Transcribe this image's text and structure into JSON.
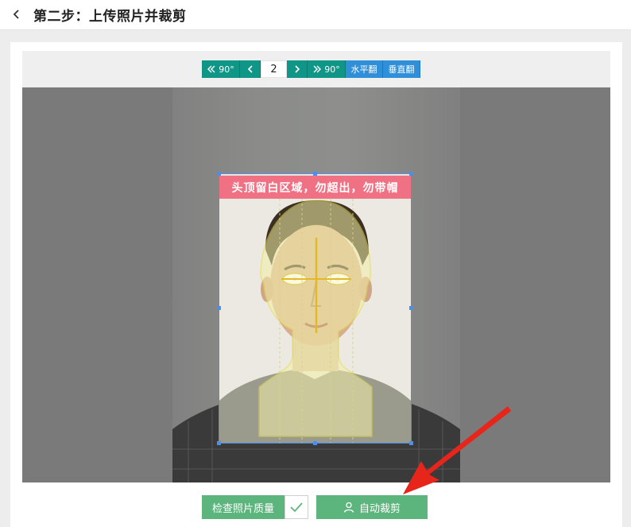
{
  "header": {
    "title": "第二步：上传照片并裁剪",
    "back_icon": "chevron-left-icon"
  },
  "toolbar": {
    "rotate_left": "90°",
    "rotate_right": "90°",
    "page_number": "2",
    "flip_horizontal": "水平翻",
    "flip_vertical": "垂直翻",
    "colors": {
      "primary": "#0f9686",
      "secondary": "#2f8fd8"
    }
  },
  "crop": {
    "banner_text": "头顶留白区域，勿超出，勿带帽",
    "banner_color": "#f07183",
    "frame_color": "#4a8ff0"
  },
  "actions": {
    "check_quality_label": "检查照片质量",
    "auto_crop_label": "自动裁剪",
    "button_color": "#5cb57c"
  },
  "annotation": {
    "arrow_color": "#e8251b"
  }
}
